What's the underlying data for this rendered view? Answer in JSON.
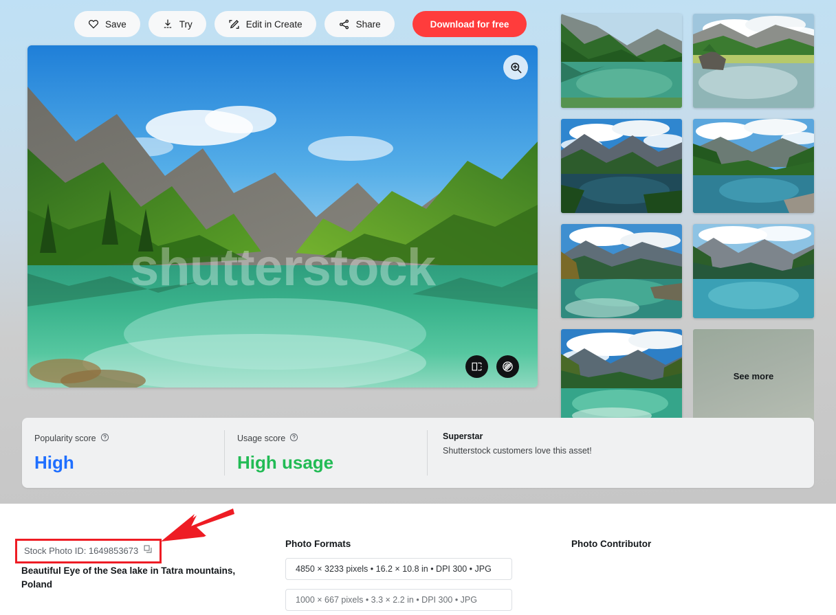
{
  "theme": {
    "accent_red": "#ff3c3c",
    "annotation_red": "#ee1c24",
    "popularity_color": "#1f6fff",
    "usage_color": "#22bb55"
  },
  "actionbar": {
    "save_label": "Save",
    "try_label": "Try",
    "edit_label": "Edit in Create",
    "share_label": "Share",
    "download_label": "Download for free"
  },
  "main_image": {
    "watermark": "shutterstock",
    "alt": "Beautiful Eye of the Sea lake in Tatra mountains, Poland",
    "zoom_icon": "magnifier-plus-icon",
    "overlay_icons": [
      "crop-expand-icon",
      "no-watermark-icon"
    ]
  },
  "thumbnails": [
    {
      "alt": "mountain lake with green forest"
    },
    {
      "alt": "alpine lake with rocky outcrop and clouds"
    },
    {
      "alt": "morskie oko lake under blue sky"
    },
    {
      "alt": "forested canyon lake with road"
    },
    {
      "alt": "autumn lake with mountain cliffs"
    },
    {
      "alt": "turquoise fjord lake with peaks"
    },
    {
      "alt": "clear lake reflecting clouds and mountains"
    }
  ],
  "see_more_label": "See more",
  "scores": {
    "popularity": {
      "label": "Popularity score",
      "value": "High",
      "help_icon": "question-circle-icon"
    },
    "usage": {
      "label": "Usage score",
      "value": "High usage",
      "help_icon": "question-circle-icon"
    },
    "badge": {
      "title": "Superstar",
      "subtitle": "Shutterstock customers love this asset!"
    }
  },
  "details": {
    "stock_id_label": "Stock Photo ID: 1649853673",
    "copy_icon": "copy-icon",
    "title": "Beautiful Eye of the Sea lake in Tatra mountains, Poland",
    "formats_heading": "Photo Formats",
    "formats": [
      "4850 × 3233 pixels • 16.2 × 10.8 in • DPI 300 • JPG",
      "1000 × 667 pixels • 3.3 × 2.2 in • DPI 300 • JPG"
    ],
    "contributor_heading": "Photo Contributor"
  }
}
